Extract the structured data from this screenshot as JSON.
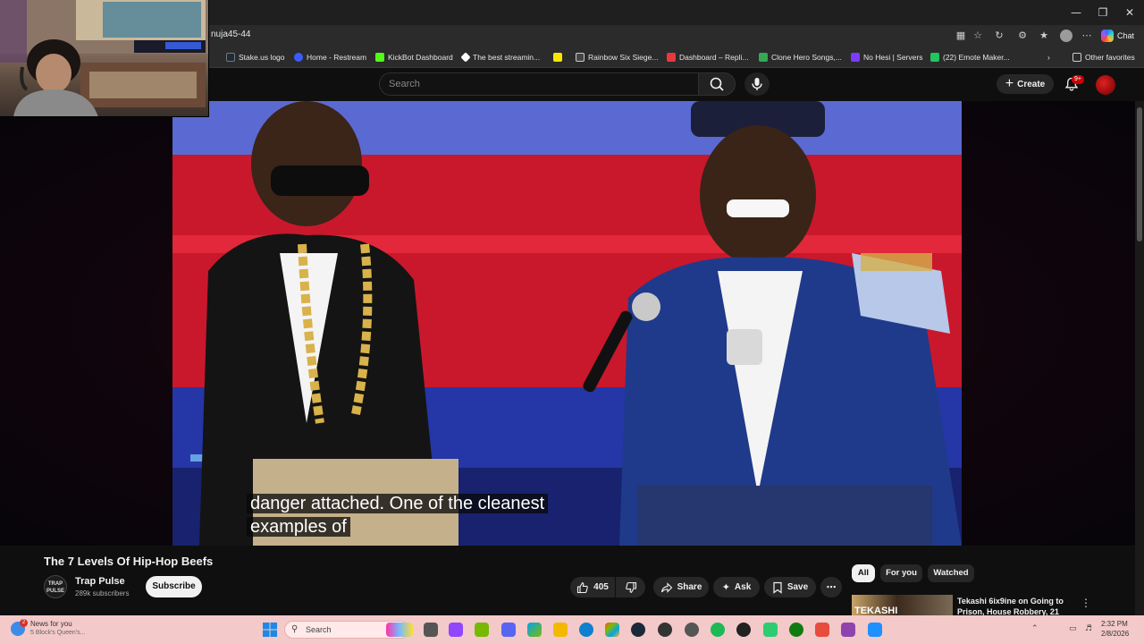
{
  "browser": {
    "url_fragment": "nuja45-44",
    "chat_label": "Chat",
    "bookmarks": [
      {
        "label": "Stake.us logo",
        "color": "#1e2b38"
      },
      {
        "label": "Home - Restream",
        "color": "#3b5bff"
      },
      {
        "label": "KickBot Dashboard",
        "color": "#53fc18"
      },
      {
        "label": "The best streamin...",
        "color": "#ffffff"
      },
      {
        "label": "",
        "color": "#f7e600"
      },
      {
        "label": "Rainbow Six Siege...",
        "color": "#ffffff"
      },
      {
        "label": "Dashboard – Repli...",
        "color": "#e8383d"
      },
      {
        "label": "Clone Hero Songs,...",
        "color": "#34a853"
      },
      {
        "label": "No Hesi | Servers",
        "color": "#7a3cff"
      },
      {
        "label": "(22) Emote Maker...",
        "color": "#22c55e"
      }
    ],
    "other_favorites": "Other favorites"
  },
  "header": {
    "search_placeholder": "Search",
    "create_label": "Create",
    "notifications_badge": "9+"
  },
  "video": {
    "caption_line1": "danger attached. One of the cleanest",
    "caption_line2": "examples of",
    "title": "The 7 Levels Of Hip-Hop Beefs"
  },
  "channel": {
    "avatar_text": "TRAP PULSE",
    "name": "Trap Pulse",
    "subscribers": "289k subscribers",
    "subscribe_label": "Subscribe"
  },
  "actions": {
    "like_count": "405",
    "share_label": "Share",
    "ask_label": "Ask",
    "save_label": "Save"
  },
  "chips": [
    "All",
    "For you",
    "Watched"
  ],
  "recommendation": {
    "thumb_text": "TEKASHI",
    "title": "Tekashi 6ix9ine on Going to Prison, House Robbery, 21"
  },
  "taskbar": {
    "news_title": "News for you",
    "news_sub": "5 Block's Queen's...",
    "news_badge": "2",
    "search_label": "Search",
    "time": "2:32 PM",
    "date": "2/8/2026",
    "app_colors": [
      "#3c8ce7",
      "#555555",
      "#9146ff",
      "#76b900",
      "#5865f2",
      "#00a4ef",
      "#f5b800",
      "#0f7fcf",
      "#c0392b",
      "#1b2838",
      "#333333",
      "#555555",
      "#1db954",
      "#222222",
      "#2ecc71",
      "#107c10",
      "#e74c3c",
      "#8e44ad",
      "#1e90ff"
    ]
  }
}
